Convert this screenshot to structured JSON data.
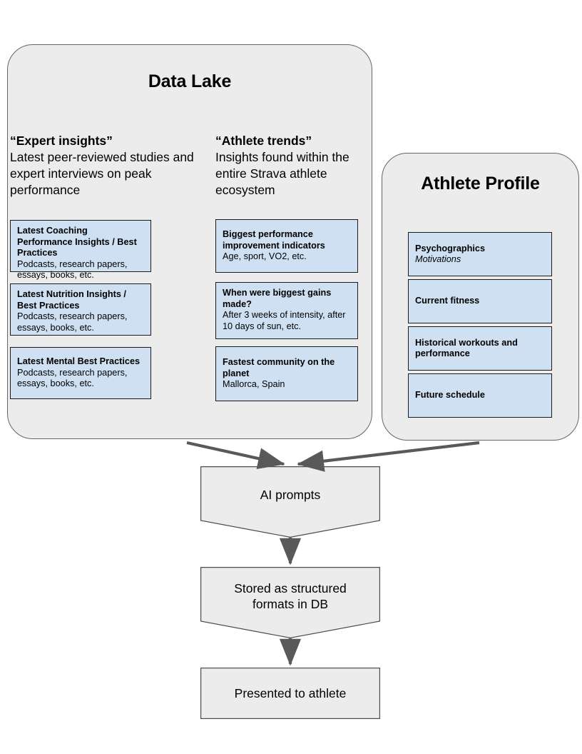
{
  "colors": {
    "group_fill": "#ececec",
    "group_stroke": "#666666",
    "card_fill": "#cfe0f3",
    "card_stroke": "#1b1b1b",
    "flow_fill": "#ececec",
    "flow_stroke": "#4d4d4d",
    "arrow": "#595959",
    "text": "#000000"
  },
  "data_lake": {
    "title": "Data Lake",
    "columns": [
      {
        "heading": "“Expert insights”",
        "description": "Latest peer-reviewed studies and expert interviews on peak performance",
        "cards": [
          {
            "title": "Latest Coaching Performance Insights / Best Practices",
            "subtitle": "Podcasts, research papers, essays, books, etc."
          },
          {
            "title": "Latest Nutrition Insights / Best Practices",
            "subtitle": "Podcasts, research papers, essays, books, etc."
          },
          {
            "title": "Latest Mental Best Practices",
            "subtitle": "Podcasts, research papers, essays, books, etc."
          }
        ]
      },
      {
        "heading": "“Athlete trends”",
        "description": "Insights found within the entire Strava athlete ecosystem",
        "cards": [
          {
            "title": "Biggest performance improvement indicators",
            "subtitle": "Age, sport, VO2, etc."
          },
          {
            "title": "When were biggest gains made?",
            "subtitle": "After 3 weeks of intensity, after 10 days of sun, etc."
          },
          {
            "title": "Fastest community on the planet",
            "subtitle": "Mallorca, Spain"
          }
        ]
      }
    ]
  },
  "athlete_profile": {
    "title": "Athlete Profile",
    "cards": [
      {
        "title": "Psychographics",
        "subtitle": "Motivations",
        "subtitle_italic": true
      },
      {
        "title": "Current fitness",
        "subtitle": ""
      },
      {
        "title": "Historical workouts and performance",
        "subtitle": ""
      },
      {
        "title": "Future schedule",
        "subtitle": ""
      }
    ]
  },
  "flow": {
    "steps": [
      {
        "label": "AI prompts",
        "shape": "manual-operation"
      },
      {
        "label": "Stored as structured\nformats in DB",
        "shape": "manual-operation"
      },
      {
        "label": "Presented to athlete",
        "shape": "rectangle"
      }
    ]
  }
}
